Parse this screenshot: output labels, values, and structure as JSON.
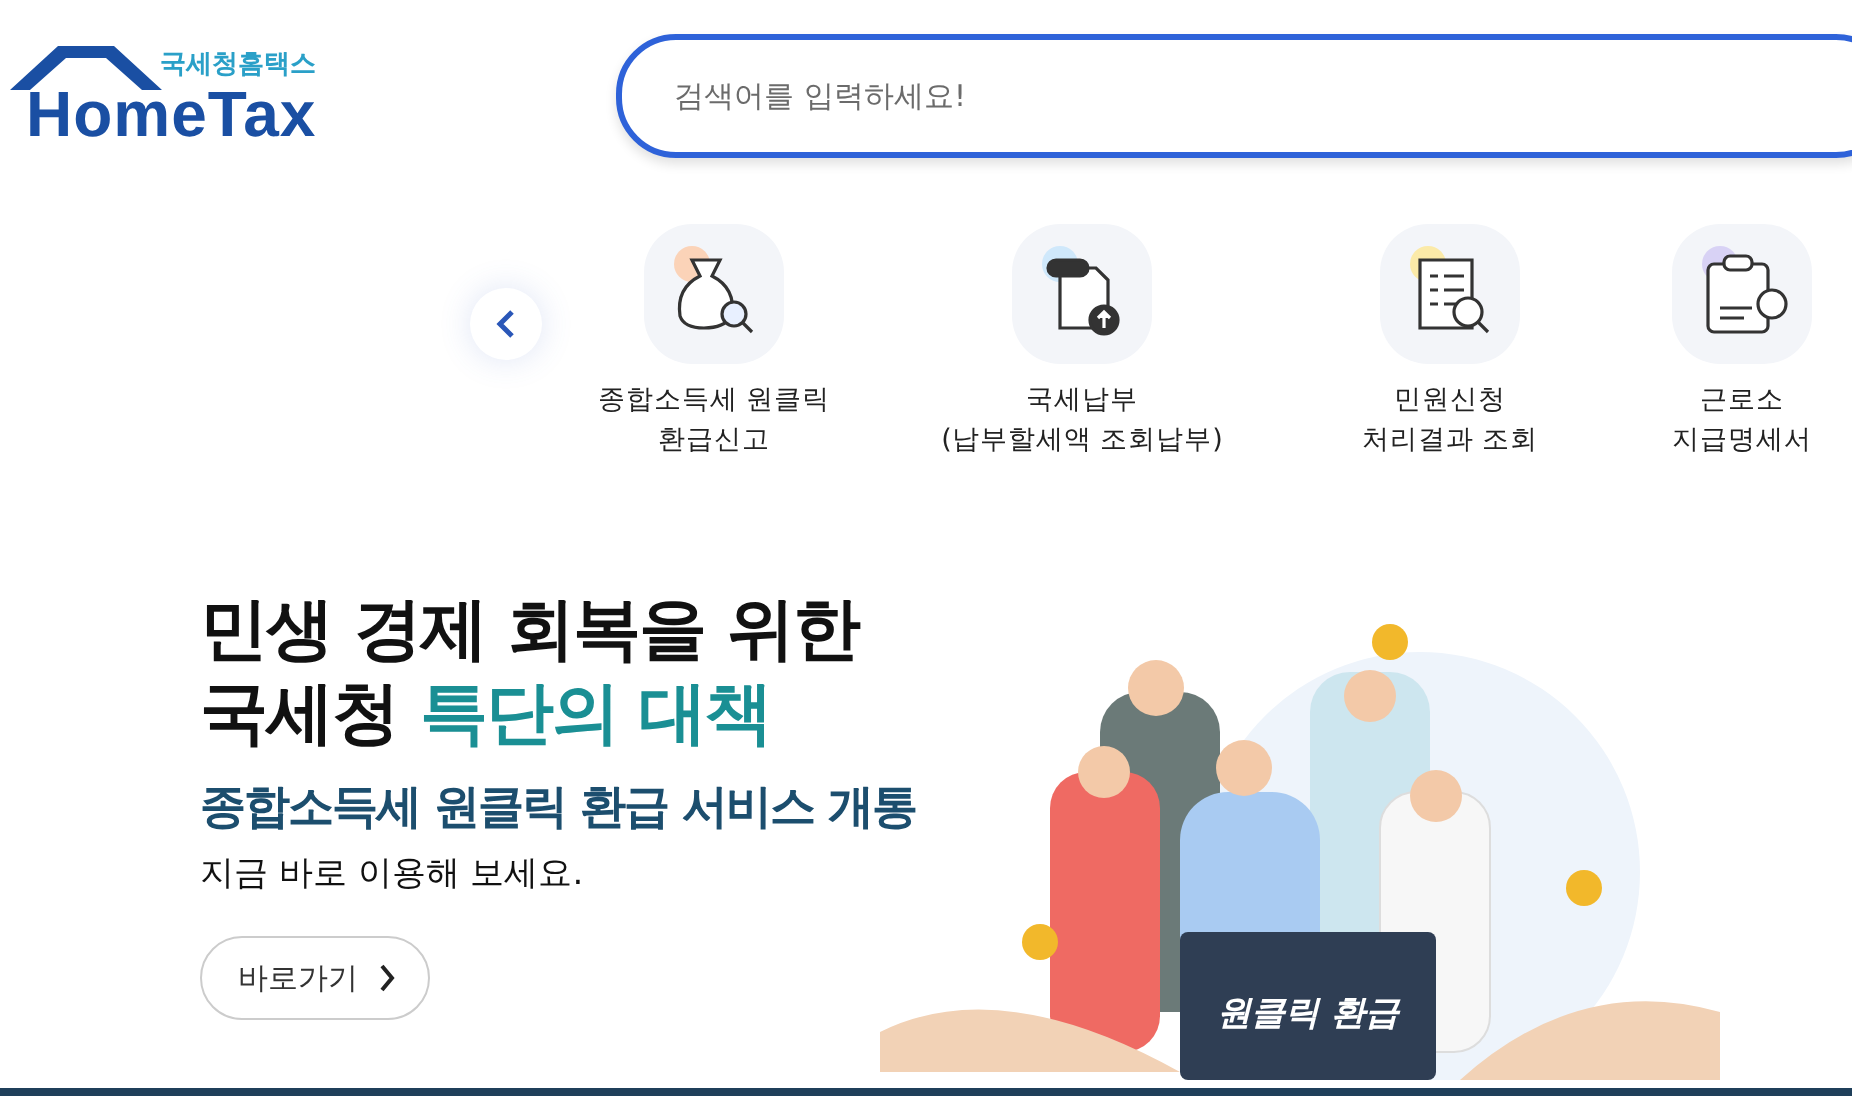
{
  "logo": {
    "subtitle": "국세청홈택스",
    "title": "HomeTax"
  },
  "search": {
    "placeholder": "검색어를 입력하세요!"
  },
  "quick_menu": {
    "items": [
      {
        "kind": "refund",
        "lines": [
          "종합소득세 원클릭",
          "환급신고"
        ]
      },
      {
        "kind": "payment",
        "lines": [
          "국세납부",
          "(납부할세액 조회납부)"
        ]
      },
      {
        "kind": "inquiry",
        "lines": [
          "민원신청",
          "처리결과 조회"
        ]
      },
      {
        "kind": "statement",
        "lines": [
          "근로소",
          "지급명세서"
        ]
      }
    ]
  },
  "banner": {
    "title_line1": "민생 경제 회복을 위한",
    "title_line2_plain": "국세청",
    "title_line2_accent": "특단의 대책",
    "subtitle": "종합소득세 원클릭 환급 서비스 개통",
    "body": "지금 바로 이용해 보세요.",
    "button": "바로가기",
    "sign": "원클릭 환급"
  }
}
